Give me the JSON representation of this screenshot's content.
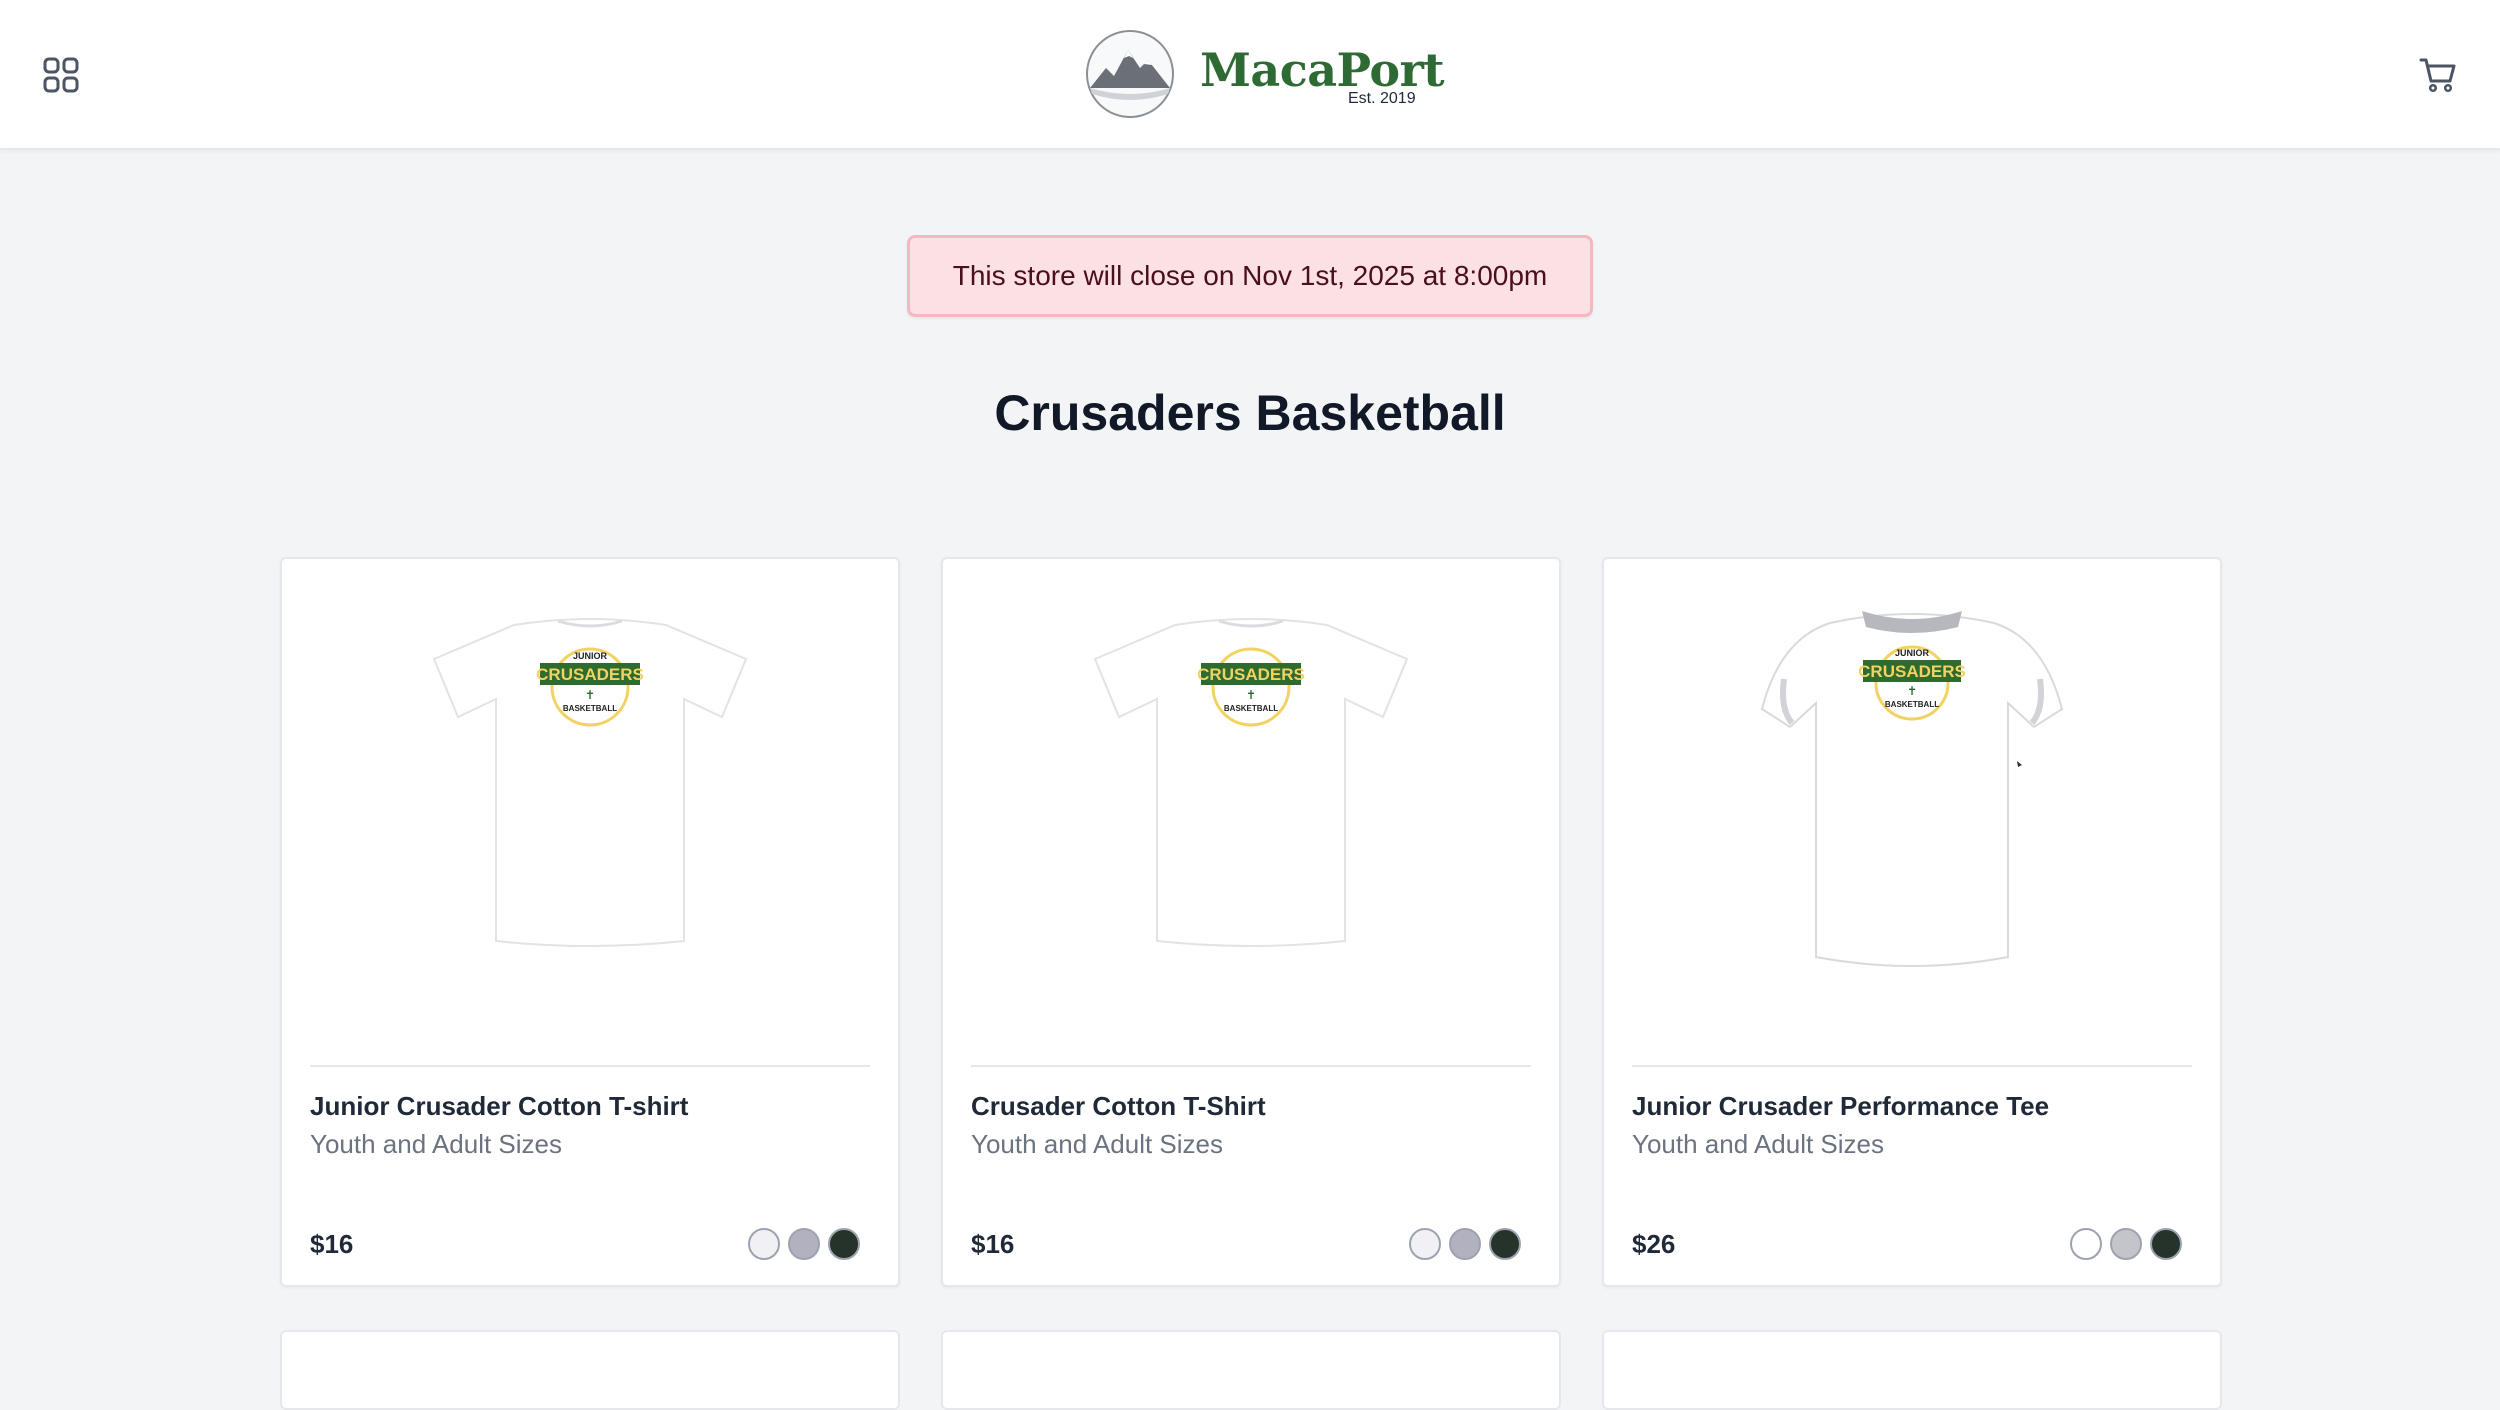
{
  "header": {
    "brand_name": "MacaPort",
    "brand_tagline": "Est. 2019",
    "menu_icon": "grid-icon",
    "cart_icon": "shopping-cart-icon"
  },
  "notice": {
    "text": "This store will close on Nov 1st, 2025 at 8:00pm"
  },
  "store": {
    "title": "Crusaders Basketball"
  },
  "products": [
    {
      "name": "Junior Crusader Cotton T-shirt",
      "subtitle": "Youth and Adult Sizes",
      "price": "$16",
      "image_label_top": "JUNIOR",
      "image_label_main": "CRUSADERS",
      "image_label_bottom": "BASKETBALL",
      "swatches": [
        "#f1f1f5",
        "#b2b1bf",
        "#25332a"
      ]
    },
    {
      "name": "Crusader Cotton T-Shirt",
      "subtitle": "Youth and Adult Sizes",
      "price": "$16",
      "image_label_main": "CRUSADERS",
      "image_label_bottom": "BASKETBALL",
      "swatches": [
        "#f1f1f5",
        "#b2b1bf",
        "#25332a"
      ]
    },
    {
      "name": "Junior Crusader Performance Tee",
      "subtitle": "Youth and Adult Sizes",
      "price": "$26",
      "image_label_top": "JUNIOR",
      "image_label_main": "CRUSADERS",
      "image_label_bottom": "BASKETBALL",
      "swatches": [
        "#ffffff",
        "#c4c4cb",
        "#25332a"
      ]
    }
  ],
  "colors": {
    "brand_green": "#2e6b34",
    "notice_bg": "#fbe0e4",
    "notice_text": "#4a0e1c",
    "shirt_accent_yellow": "#f2d260",
    "shirt_accent_green": "#2f6a2e"
  }
}
